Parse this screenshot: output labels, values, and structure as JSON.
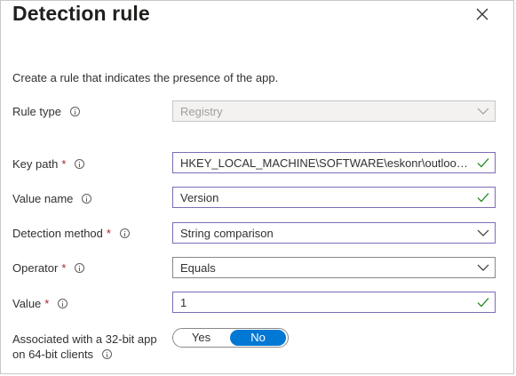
{
  "panel": {
    "title": "Detection rule",
    "intro": "Create a rule that indicates the presence of the app."
  },
  "fields": {
    "rule_type": {
      "label": "Rule type",
      "value": "Registry"
    },
    "key_path": {
      "label": "Key path",
      "value": "HKEY_LOCAL_MACHINE\\SOFTWARE\\eskonr\\outlooksafesender"
    },
    "value_name": {
      "label": "Value name",
      "value": "Version"
    },
    "detection_method": {
      "label": "Detection method",
      "value": "String comparison"
    },
    "operator": {
      "label": "Operator",
      "value": "Equals"
    },
    "value": {
      "label": "Value",
      "value": "1"
    },
    "associated": {
      "label_line1": "Associated with a 32-bit app",
      "label_line2": "on 64-bit clients",
      "options": [
        "Yes",
        "No"
      ],
      "selected": "No"
    }
  },
  "required_mark": "*",
  "colors": {
    "accent": "#0078d4",
    "valid_border": "#7f6bb5",
    "check": "#107c10",
    "required": "#a4262c"
  },
  "icons": [
    "close-icon",
    "info-icon",
    "chevron-down-icon",
    "checkmark-icon"
  ]
}
